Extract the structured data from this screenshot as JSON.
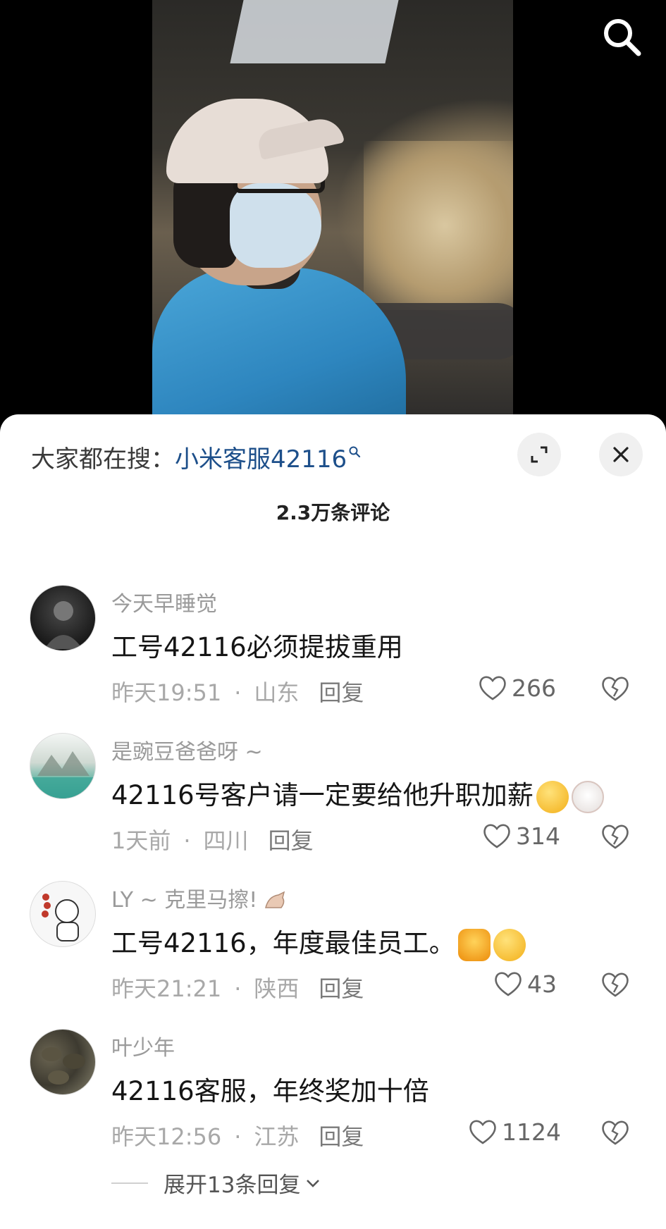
{
  "header": {
    "search_icon": "search-icon"
  },
  "sheet": {
    "hot_search_prefix": "大家都在搜：",
    "hot_search_keyword": "小米客服42116",
    "comment_count": "2.3万条评论",
    "expand_icon": "expand-icon",
    "close_icon": "close-icon"
  },
  "comments": [
    {
      "user": "今天早睡觉",
      "text": "工号42116必须提拔重用",
      "time": "昨天19:51",
      "location": "山东",
      "reply": "回复",
      "likes": "266"
    },
    {
      "user": "是豌豆爸爸呀 ~",
      "text": "42116号客户请一定要给他升职加薪",
      "time": "1天前",
      "location": "四川",
      "reply": "回复",
      "likes": "314"
    },
    {
      "user": "LY ~ 克里马擦!",
      "text": "工号42116，年度最佳员工。",
      "time": "昨天21:21",
      "location": "陕西",
      "reply": "回复",
      "likes": "43"
    },
    {
      "user": "叶少年",
      "text": "42116客服，年终奖加十倍",
      "time": "昨天12:56",
      "location": "江苏",
      "reply": "回复",
      "likes": "1124"
    }
  ],
  "expand_replies": "展开13条回复",
  "colors": {
    "keyword": "#1d4f8a",
    "meta": "#a8a8a8",
    "text": "#151515"
  }
}
